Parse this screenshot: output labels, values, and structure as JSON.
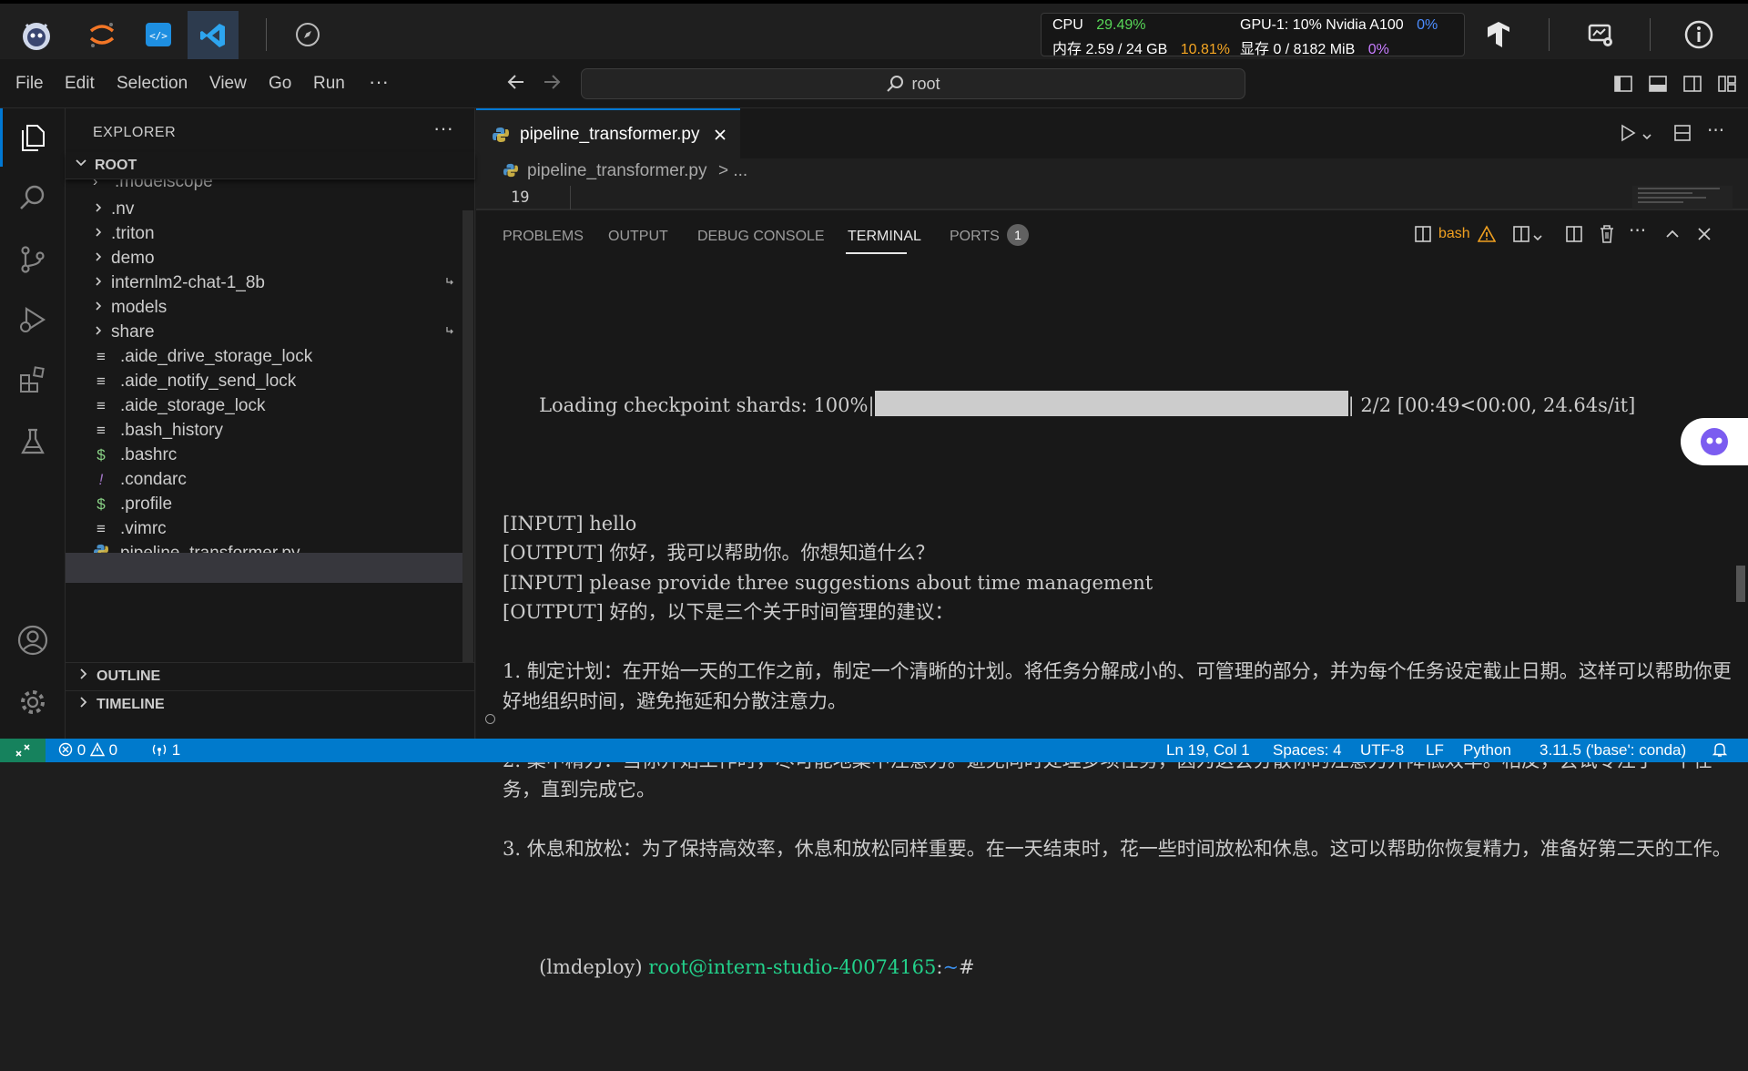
{
  "host": {
    "stats": {
      "cpu_label": "CPU",
      "cpu_value": "29.49%",
      "gpu_label": "GPU-1: 10% Nvidia A100",
      "gpu_value": "0%",
      "mem_label": "内存 2.59 / 24 GB",
      "mem_value": "10.81%",
      "vram_label": "显存 0 / 8182 MiB",
      "vram_value": "0%"
    }
  },
  "menu": {
    "items": [
      "File",
      "Edit",
      "Selection",
      "View",
      "Go",
      "Run"
    ],
    "more": "···",
    "search_text": "root"
  },
  "explorer": {
    "title": "EXPLORER",
    "root_label": "ROOT",
    "clipped_item": ".modelscope",
    "items": [
      {
        "label": ".nv",
        "kind": "folder"
      },
      {
        "label": ".triton",
        "kind": "folder"
      },
      {
        "label": "demo",
        "kind": "folder"
      },
      {
        "label": "internlm2-chat-1_8b",
        "kind": "folder-link"
      },
      {
        "label": "models",
        "kind": "folder"
      },
      {
        "label": "share",
        "kind": "folder-link"
      },
      {
        "label": ".aide_drive_storage_lock",
        "kind": "file"
      },
      {
        "label": ".aide_notify_send_lock",
        "kind": "file"
      },
      {
        "label": ".aide_storage_lock",
        "kind": "file"
      },
      {
        "label": ".bash_history",
        "kind": "file"
      },
      {
        "label": ".bashrc",
        "kind": "shell"
      },
      {
        "label": ".condarc",
        "kind": "yaml"
      },
      {
        "label": ".profile",
        "kind": "shell"
      },
      {
        "label": ".vimrc",
        "kind": "file"
      },
      {
        "label": "pipeline_transformer.py",
        "kind": "python"
      }
    ],
    "outline_label": "OUTLINE",
    "timeline_label": "TIMELINE"
  },
  "editor": {
    "tab_label": "pipeline_transformer.py",
    "breadcrumb_file": "pipeline_transformer.py",
    "breadcrumb_rest": "> ...",
    "line_number": "19"
  },
  "panel": {
    "tabs": [
      "PROBLEMS",
      "OUTPUT",
      "DEBUG CONSOLE",
      "TERMINAL",
      "PORTS"
    ],
    "active_tab": "TERMINAL",
    "ports_badge": "1",
    "shell_label": "bash",
    "progress_prefix": "Loading checkpoint shards: 100%|",
    "progress_fraction": 1.0,
    "progress_suffix": "| 2/2 [00:49<00:00, 24.64s/it]",
    "lines": [
      "[INPUT] hello",
      "[OUTPUT] 你好，我可以帮助你。你想知道什么？",
      "[INPUT] please provide three suggestions about time management",
      "[OUTPUT] 好的，以下是三个关于时间管理的建议：",
      "",
      "1. 制定计划：在开始一天的工作之前，制定一个清晰的计划。将任务分解成小的、可管理的部分，并为每个任务设定截止日期。这样可以帮助你更好地组织时间，避免拖延和分散注意力。",
      "",
      "2. 集中精力：当你开始工作时，尽可能地集中注意力。避免同时处理多项任务，因为这会分散你的注意力并降低效率。相反，尝试专注于一个任务，直到完成它。",
      "",
      "3. 休息和放松：为了保持高效率，休息和放松同样重要。在一天结束时，花一些时间放松和休息。这可以帮助你恢复精力，准备好第二天的工作。"
    ],
    "prompt_env": "(lmdeploy) ",
    "prompt_user": "root@intern-studio-40074165",
    "prompt_colon": ":",
    "prompt_path": "~",
    "prompt_hash": "#"
  },
  "status": {
    "errors": "0",
    "warnings": "0",
    "ports": "1",
    "position": "Ln 19, Col 1",
    "spaces": "Spaces: 4",
    "encoding": "UTF-8",
    "eol": "LF",
    "language": "Python",
    "interpreter": "3.11.5 ('base': conda)"
  },
  "colors": {
    "accent": "#0078d4",
    "statusbar": "#007acc",
    "prompt_green": "#23d18b",
    "prompt_blue": "#3b8eea"
  }
}
